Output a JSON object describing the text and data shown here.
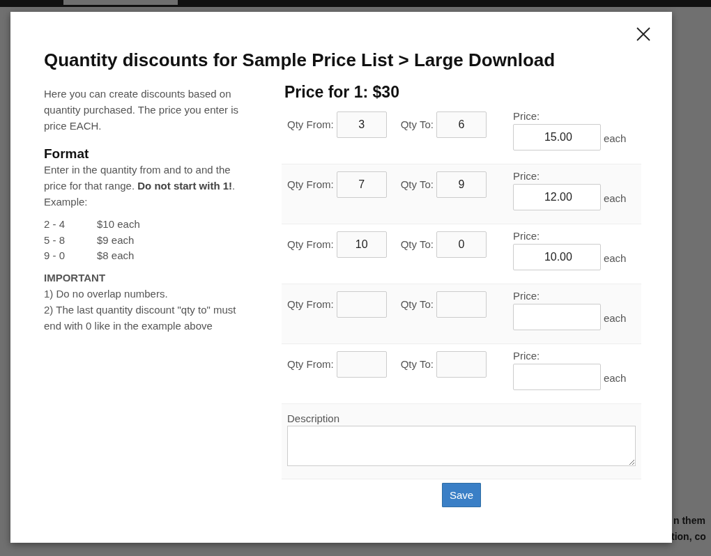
{
  "background": {
    "side_text": [
      "n them",
      "tion, co"
    ]
  },
  "dialog": {
    "title": "Quantity discounts for Sample Price List > Large Download",
    "intro": "Here you can create discounts based on quantity purchased. The price you enter is price EACH.",
    "format_heading": "Format",
    "format_text": "Enter in the quantity from and to and the price for that range. **Do not start with 1!**. Example:",
    "examples": [
      {
        "range": "2 - 4",
        "price": "$10 each"
      },
      {
        "range": "5 - 8",
        "price": "$9 each"
      },
      {
        "range": "9 - 0",
        "price": "$8 each"
      }
    ],
    "important_heading": "IMPORTANT",
    "important_lines": [
      "1) Do no overlap numbers.",
      "2) The last quantity discount \"qty to\" must end with 0 like in the example above"
    ],
    "price_heading": "Price for 1: $30",
    "tiers": [
      {
        "from_label": "Qty From:",
        "from": "3",
        "to_label": "Qty To:",
        "to": "6",
        "price_label": "Price:",
        "price": "15.00",
        "unit": "each"
      },
      {
        "from_label": "Qty From:",
        "from": "7",
        "to_label": "Qty To:",
        "to": "9",
        "price_label": "Price:",
        "price": "12.00",
        "unit": "each"
      },
      {
        "from_label": "Qty From:",
        "from": "10",
        "to_label": "Qty To:",
        "to": "0",
        "price_label": "Price:",
        "price": "10.00",
        "unit": "each"
      },
      {
        "from_label": "Qty From:",
        "to_label": "Qty To:",
        "price_label": "Price:",
        "unit": "each"
      },
      {
        "from_label": "Qty From:",
        "to_label": "Qty To:",
        "price_label": "Price:",
        "unit": "each"
      }
    ],
    "description_label": "Description",
    "save_button": "Save"
  }
}
